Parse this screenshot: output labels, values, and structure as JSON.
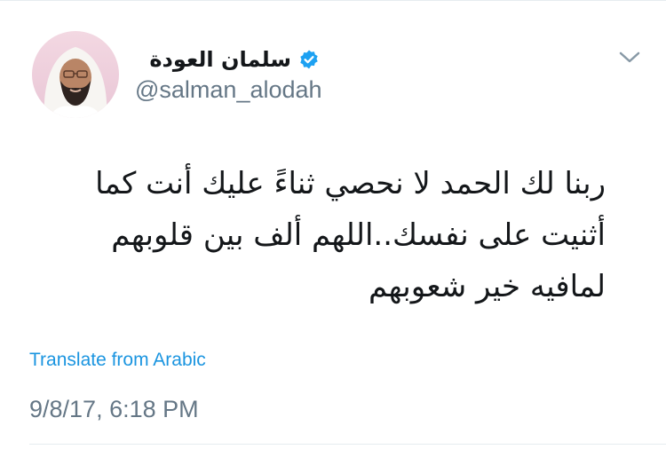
{
  "tweet": {
    "author": {
      "display_name": "سلمان العودة",
      "handle": "@salman_alodah",
      "verified": true,
      "avatar_icon": "profile-photo"
    },
    "menu_icon": "chevron-down-icon",
    "text": "ربنا لك الحمد لا نحصي ثناءً عليك أنت كما أثنيت على نفسك..اللهم ألف بين قلوبهم لمافيه خير شعوبهم",
    "translate_label": "Translate from Arabic",
    "timestamp": "9/8/17, 6:18 PM"
  },
  "colors": {
    "link": "#1b95e0",
    "secondary_text": "#657786",
    "primary_text": "#14171a",
    "divider": "#e6ecf0",
    "verified_badge": "#1da1f2"
  }
}
